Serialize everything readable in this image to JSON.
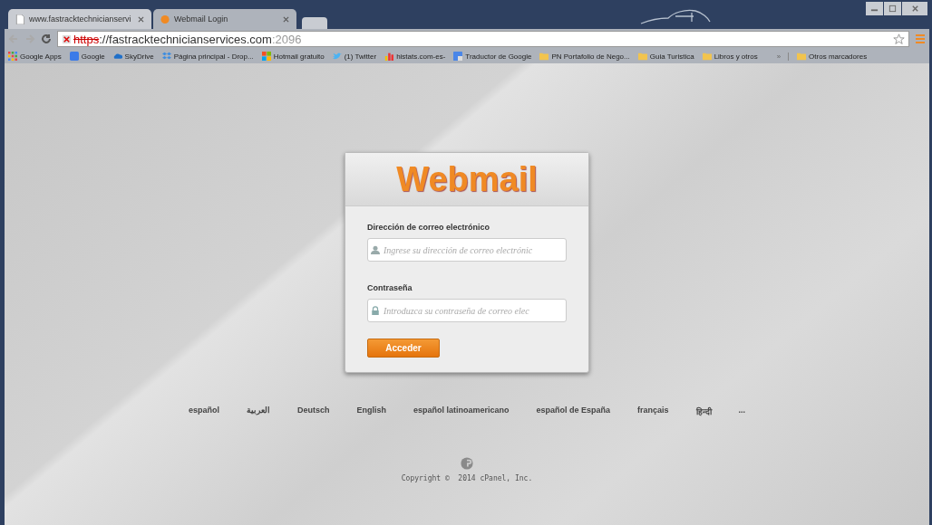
{
  "tabs": [
    {
      "title": "www.fastracktechnicianservi",
      "kind": "page",
      "selected": false
    },
    {
      "title": "Webmail Login",
      "kind": "cpanel",
      "selected": true
    }
  ],
  "address_bar": {
    "scheme": "https",
    "host": "://fastracktechnicianservices.com",
    "port": ":2096",
    "insecure": true
  },
  "bookmarks": [
    {
      "label": "Google Apps",
      "kind": "apps"
    },
    {
      "label": "Google",
      "kind": "google"
    },
    {
      "label": "SkyDrive",
      "kind": "cloud"
    },
    {
      "label": "Página principal - Drop...",
      "kind": "dropbox"
    },
    {
      "label": "Hotmail gratuito",
      "kind": "windows"
    },
    {
      "label": "(1) Twitter",
      "kind": "bird"
    },
    {
      "label": "histats.com-es-",
      "kind": "bars"
    },
    {
      "label": "Traductor de Google",
      "kind": "translate"
    },
    {
      "label": "PN Portafolio de Nego...",
      "kind": "folder"
    },
    {
      "label": "Guia Turistica",
      "kind": "folder"
    },
    {
      "label": "Libros y otros",
      "kind": "folder"
    }
  ],
  "bookmarks_more": "»",
  "other_bookmarks": "Otros marcadores",
  "login": {
    "logo": "Webmail",
    "email_label": "Dirección de correo electrónico",
    "email_placeholder": "Ingrese su dirección de correo electrónic",
    "password_label": "Contraseña",
    "password_placeholder": "Introduzca su contraseña de correo elec",
    "submit": "Acceder"
  },
  "languages": [
    "español",
    "العربية",
    "Deutsch",
    "English",
    "español latinoamericano",
    "español de España",
    "français",
    "हिन्दी",
    "..."
  ],
  "copyright": "Copyright ©  2014 cPanel, Inc."
}
